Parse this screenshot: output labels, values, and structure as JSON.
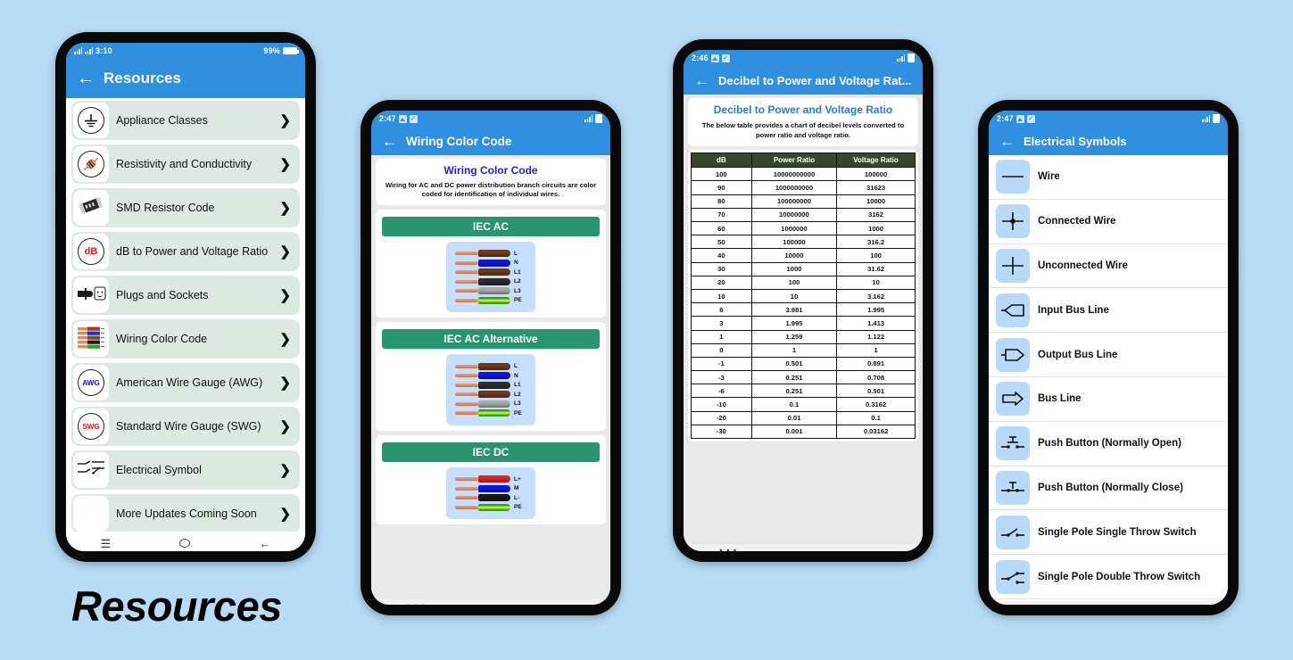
{
  "background_color": "#b8dcf6",
  "accent_blue": "#2f8fe0",
  "caption": "Resources",
  "phone1": {
    "status": {
      "time": "3:10",
      "battery_percent": "99%",
      "network": "4G"
    },
    "appbar": {
      "back_icon": "arrow-left-icon",
      "title": "Resources"
    },
    "items": [
      {
        "label": "Appliance Classes",
        "icon": "earth-ground-icon"
      },
      {
        "label": "Resistivity and Conductivity",
        "icon": "resistor-icon"
      },
      {
        "label": "SMD Resistor Code",
        "icon": "smd-resistor-icon"
      },
      {
        "label": "dB to Power and Voltage Ratio",
        "icon": "db-badge-icon",
        "badge": "dB"
      },
      {
        "label": "Plugs and Sockets",
        "icon": "plug-socket-icon"
      },
      {
        "label": "Wiring Color Code",
        "icon": "wire-colors-icon"
      },
      {
        "label": "American Wire Gauge (AWG)",
        "icon": "awg-badge-icon",
        "badge": "AWG"
      },
      {
        "label": "Standard Wire Gauge (SWG)",
        "icon": "swg-badge-icon",
        "badge": "SWG"
      },
      {
        "label": "Electrical Symbol",
        "icon": "switch-symbol-icon"
      },
      {
        "label": "More Updates Coming Soon",
        "icon": "blank-icon"
      }
    ],
    "chevron": "❯",
    "navbar": {
      "recents": "recents-icon",
      "home": "home-icon",
      "back": "back-icon"
    }
  },
  "phone2": {
    "status": {
      "time": "2:47"
    },
    "appbar": {
      "back_icon": "arrow-left-icon",
      "title": "Wiring Color Code"
    },
    "intro": {
      "heading": "Wiring Color Code",
      "body": "Wiring for AC and DC power distribution branch circuits are color coded for identification of individual wires."
    },
    "sections": [
      {
        "title": "IEC AC",
        "wires": [
          {
            "label": "L",
            "color": "#6b3b1a"
          },
          {
            "label": "N",
            "color": "#0d16e8"
          },
          {
            "label": "L1",
            "color": "#6b3b1a"
          },
          {
            "label": "L2",
            "color": "#2c2c2c"
          },
          {
            "label": "L3",
            "color": "#a9a9a9"
          },
          {
            "label": "PE",
            "color": "#2ba02b",
            "stripe": "#cbe52b"
          }
        ]
      },
      {
        "title": "IEC AC Alternative",
        "wires": [
          {
            "label": "L",
            "color": "#6b3b1a"
          },
          {
            "label": "N",
            "color": "#0d16e8"
          },
          {
            "label": "L1",
            "color": "#2c2c2c"
          },
          {
            "label": "L2",
            "color": "#6b3b1a"
          },
          {
            "label": "L3",
            "color": "#a9a9a9"
          },
          {
            "label": "PE",
            "color": "#2ba02b",
            "stripe": "#cbe52b"
          }
        ]
      },
      {
        "title": "IEC DC",
        "wires": [
          {
            "label": "L+",
            "color": "#e02323"
          },
          {
            "label": "M",
            "color": "#0d16e8"
          },
          {
            "label": "L-",
            "color": "#161616"
          },
          {
            "label": "PE",
            "color": "#2ba02b",
            "stripe": "#cbe52b"
          }
        ]
      }
    ],
    "navbar": {
      "recents": "recents-icon",
      "home": "home-icon",
      "back": "back-icon"
    }
  },
  "phone3": {
    "status": {
      "time": "2:46"
    },
    "appbar": {
      "back_icon": "arrow-left-icon",
      "title": "Decibel to Power and Voltage Rat..."
    },
    "intro": {
      "heading": "Decibel to Power and Voltage Ratio",
      "body": "The below table provides a chart of decibel levels converted to power ratio and voltage ratio."
    },
    "chart_data": {
      "type": "table",
      "title": "Decibel to Power and Voltage Ratio",
      "columns": [
        "dB",
        "Power Ratio",
        "Voltage Ratio"
      ],
      "rows": [
        [
          "100",
          "10000000000",
          "100000"
        ],
        [
          "90",
          "1000000000",
          "31623"
        ],
        [
          "80",
          "100000000",
          "10000"
        ],
        [
          "70",
          "10000000",
          "3162"
        ],
        [
          "60",
          "1000000",
          "1000"
        ],
        [
          "50",
          "100000",
          "316.2"
        ],
        [
          "40",
          "10000",
          "100"
        ],
        [
          "30",
          "1000",
          "31.62"
        ],
        [
          "20",
          "100",
          "10"
        ],
        [
          "10",
          "10",
          "3.162"
        ],
        [
          "6",
          "3.981",
          "1.995"
        ],
        [
          "3",
          "1.995",
          "1.413"
        ],
        [
          "1",
          "1.259",
          "1.122"
        ],
        [
          "0",
          "1",
          "1"
        ],
        [
          "-1",
          "0.501",
          "0.891"
        ],
        [
          "-3",
          "0.251",
          "0.708"
        ],
        [
          "-6",
          "0.251",
          "0.501"
        ],
        [
          "-10",
          "0.1",
          "0.3162"
        ],
        [
          "-20",
          "0.01",
          "0.1"
        ],
        [
          "-30",
          "0.001",
          "0.03162"
        ]
      ],
      "header_color": "#39462e"
    },
    "navbar": {
      "recents": "recents-icon",
      "home": "home-icon",
      "back": "back-icon"
    }
  },
  "phone4": {
    "status": {
      "time": "2:47"
    },
    "appbar": {
      "back_icon": "arrow-left-icon",
      "title": "Electrical Symbols"
    },
    "items": [
      {
        "label": "Wire",
        "icon": "wire-symbol-icon"
      },
      {
        "label": "Connected Wire",
        "icon": "connected-wire-symbol-icon"
      },
      {
        "label": "Unconnected Wire",
        "icon": "unconnected-wire-symbol-icon"
      },
      {
        "label": "Input Bus Line",
        "icon": "input-bus-line-symbol-icon"
      },
      {
        "label": "Output Bus Line",
        "icon": "output-bus-line-symbol-icon"
      },
      {
        "label": "Bus Line",
        "icon": "bus-line-symbol-icon"
      },
      {
        "label": "Push Button (Normally Open)",
        "icon": "push-button-no-symbol-icon"
      },
      {
        "label": "Push Button (Normally Close)",
        "icon": "push-button-nc-symbol-icon"
      },
      {
        "label": "Single Pole Single Throw Switch",
        "icon": "spst-switch-symbol-icon"
      },
      {
        "label": "Single Pole Double Throw Switch",
        "icon": "spdt-switch-symbol-icon"
      }
    ],
    "navbar": {
      "recents": "recents-icon",
      "home": "home-icon",
      "back": "back-icon"
    }
  }
}
